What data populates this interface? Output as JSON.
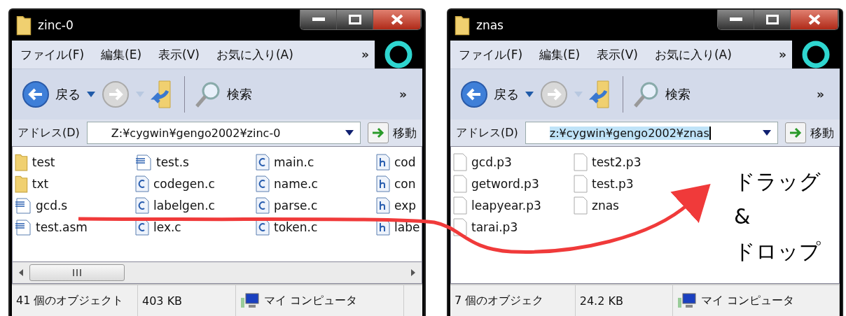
{
  "windows": [
    {
      "title": "zinc-0",
      "menu": [
        "ファイル(F)",
        "編集(E)",
        "表示(V)",
        "お気に入り(A)"
      ],
      "menu_more": "»",
      "toolbar": {
        "back": "戻る",
        "search": "検索",
        "more": "»"
      },
      "address": {
        "label": "アドレス(D)",
        "value": "Z:¥cygwin¥gengo2002¥zinc-0",
        "highlighted": false,
        "go": "移動"
      },
      "horizontal_scrollbar": true,
      "files": [
        {
          "name": "test",
          "kind": "folder"
        },
        {
          "name": "txt",
          "kind": "folder"
        },
        {
          "name": "gcd.s",
          "kind": "asm"
        },
        {
          "name": "test.asm",
          "kind": "asm"
        },
        {
          "name": "test.s",
          "kind": "asm"
        },
        {
          "name": "codegen.c",
          "kind": "c"
        },
        {
          "name": "labelgen.c",
          "kind": "c"
        },
        {
          "name": "lex.c",
          "kind": "c"
        },
        {
          "name": "main.c",
          "kind": "c"
        },
        {
          "name": "name.c",
          "kind": "c"
        },
        {
          "name": "parse.c",
          "kind": "c"
        },
        {
          "name": "token.c",
          "kind": "c"
        },
        {
          "name": "cod",
          "kind": "h"
        },
        {
          "name": "con",
          "kind": "h"
        },
        {
          "name": "exp",
          "kind": "h"
        },
        {
          "name": "labe",
          "kind": "h"
        }
      ],
      "status": {
        "count": "41 個のオブジェクト",
        "size": "403 KB",
        "location": "マイ コンピュータ"
      }
    },
    {
      "title": "znas",
      "menu": [
        "ファイル(F)",
        "編集(E)",
        "表示(V)",
        "お気に入り(A)"
      ],
      "menu_more": "»",
      "toolbar": {
        "back": "戻る",
        "search": "検索",
        "more": "»"
      },
      "address": {
        "label": "アドレス(D)",
        "value": "z:¥cygwin¥gengo2002¥znas",
        "highlighted": true,
        "go": "移動"
      },
      "horizontal_scrollbar": false,
      "files": [
        {
          "name": "gcd.p3",
          "kind": "file"
        },
        {
          "name": "getword.p3",
          "kind": "file"
        },
        {
          "name": "leapyear.p3",
          "kind": "file"
        },
        {
          "name": "tarai.p3",
          "kind": "file"
        },
        {
          "name": "test2.p3",
          "kind": "file"
        },
        {
          "name": "test.p3",
          "kind": "file"
        },
        {
          "name": "znas",
          "kind": "file"
        }
      ],
      "status": {
        "count": "7 個のオブジェク",
        "size": "24.2 KB",
        "location": "マイ コンピュータ"
      }
    }
  ],
  "annotation": {
    "lines": [
      "ドラッグ",
      "&",
      "ドロップ"
    ]
  }
}
